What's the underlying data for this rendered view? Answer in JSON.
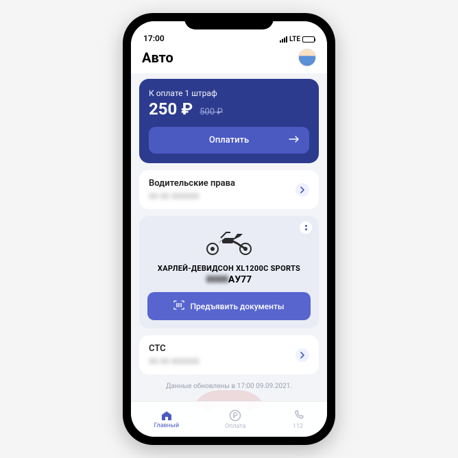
{
  "status": {
    "time": "17:00",
    "network": "LTE"
  },
  "header": {
    "title": "Авто"
  },
  "payment": {
    "label": "К оплате  1 штраф",
    "amount": "250 ₽",
    "old": "500 ₽",
    "button": "Оплатить"
  },
  "license": {
    "title": "Водительские права",
    "value": "00 00 000000"
  },
  "vehicle": {
    "name": "ХАРЛЕЙ-ДЕВИДСОН XL1200C SPORTS",
    "plate_hidden": "0000",
    "plate_visible": "АУ77",
    "present": "Предъявить документы"
  },
  "sts": {
    "title": "СТС",
    "value": "00 00 000000"
  },
  "updated": "Данные обновлены в 17:00 09.09.2021.",
  "tabs": {
    "home": "Главный",
    "pay": "Оплата",
    "sos": "112"
  }
}
